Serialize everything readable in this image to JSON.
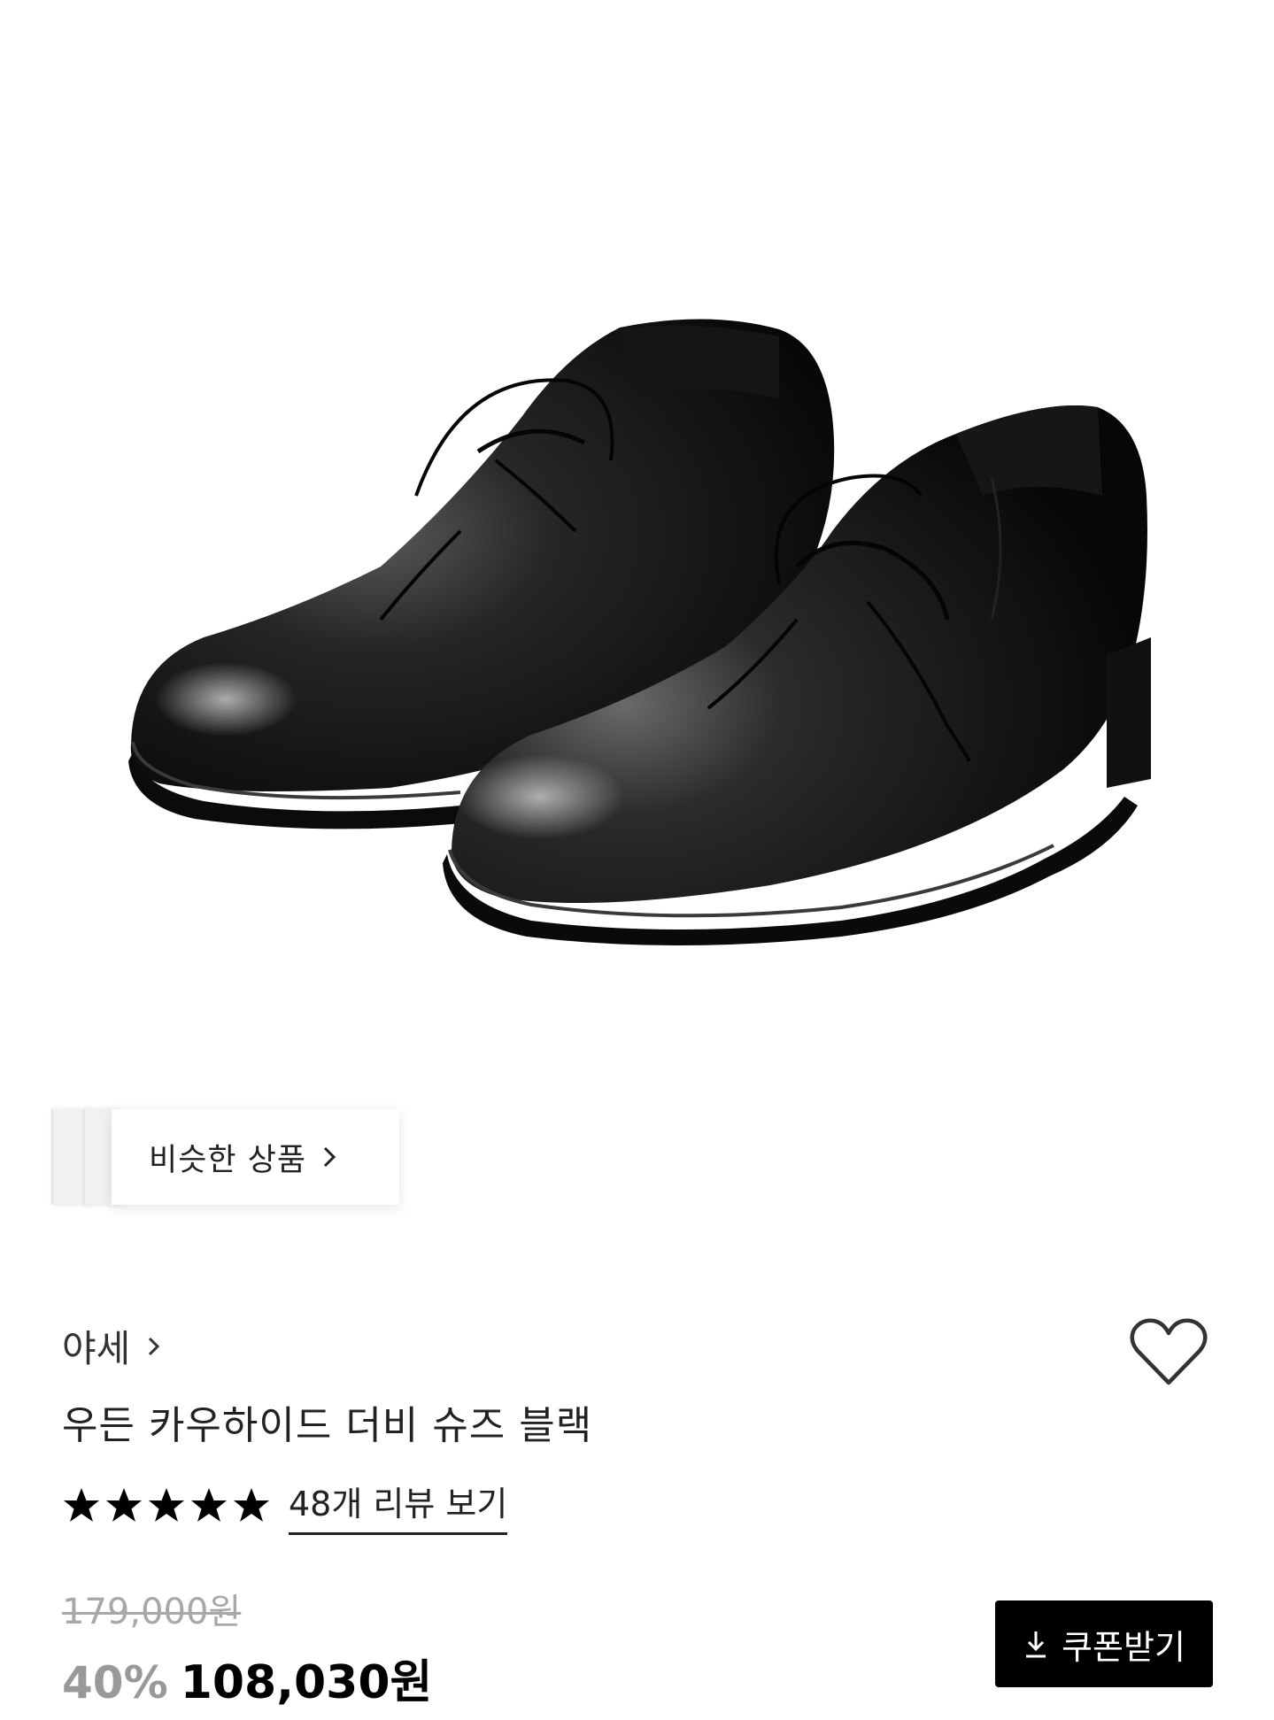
{
  "similar": {
    "label": "비슷한 상품"
  },
  "brand": {
    "name": "야세"
  },
  "product": {
    "name": "우든 카우하이드 더비 슈즈 블랙"
  },
  "rating": {
    "stars": 5,
    "max": 5,
    "review_link": "48개 리뷰 보기"
  },
  "price": {
    "original": "179,000원",
    "discount": "40%",
    "sale": "108,030원"
  },
  "coupon": {
    "label": "쿠폰받기"
  },
  "icons": {
    "brand_arrow": "chevron-right-icon",
    "wishlist": "heart-icon",
    "coupon": "download-icon"
  }
}
